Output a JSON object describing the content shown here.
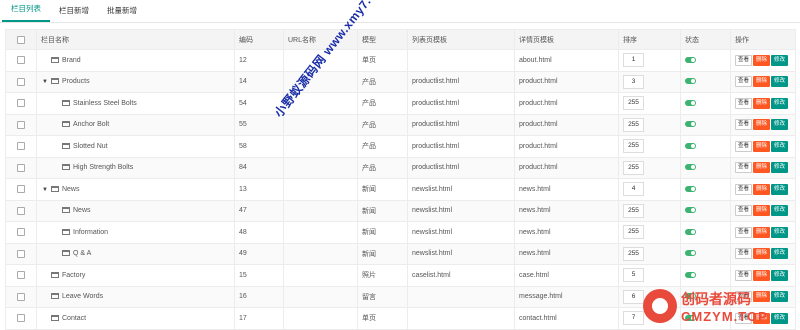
{
  "tabs": [
    "栏目列表",
    "栏目新增",
    "批量新增"
  ],
  "columns": [
    "",
    "栏目名称",
    "编码",
    "URL名称",
    "模型",
    "列表页模板",
    "详情页模板",
    "排序",
    "状态",
    "操作"
  ],
  "actions": {
    "view": "查看",
    "delete": "删除",
    "edit": "修改"
  },
  "rows": [
    {
      "name": "Brand",
      "code": "12",
      "url": "",
      "model": "单页",
      "list_tpl": "",
      "detail_tpl": "about.html",
      "sort": "1",
      "level": 1,
      "expanded": false
    },
    {
      "name": "Products",
      "code": "14",
      "url": "",
      "model": "产品",
      "list_tpl": "productlist.html",
      "detail_tpl": "product.html",
      "sort": "3",
      "level": 1,
      "expanded": true
    },
    {
      "name": "Stainless Steel Bolts",
      "code": "54",
      "url": "",
      "model": "产品",
      "list_tpl": "productlist.html",
      "detail_tpl": "product.html",
      "sort": "255",
      "level": 2,
      "expanded": false
    },
    {
      "name": "Anchor Bolt",
      "code": "55",
      "url": "",
      "model": "产品",
      "list_tpl": "productlist.html",
      "detail_tpl": "product.html",
      "sort": "255",
      "level": 2,
      "expanded": false
    },
    {
      "name": "Slotted Nut",
      "code": "58",
      "url": "",
      "model": "产品",
      "list_tpl": "productlist.html",
      "detail_tpl": "product.html",
      "sort": "255",
      "level": 2,
      "expanded": false
    },
    {
      "name": "High Strength Bolts",
      "code": "84",
      "url": "",
      "model": "产品",
      "list_tpl": "productlist.html",
      "detail_tpl": "product.html",
      "sort": "255",
      "level": 2,
      "expanded": false
    },
    {
      "name": "News",
      "code": "13",
      "url": "",
      "model": "新闻",
      "list_tpl": "newslist.html",
      "detail_tpl": "news.html",
      "sort": "4",
      "level": 1,
      "expanded": true
    },
    {
      "name": "News",
      "code": "47",
      "url": "",
      "model": "新闻",
      "list_tpl": "newslist.html",
      "detail_tpl": "news.html",
      "sort": "255",
      "level": 2,
      "expanded": false
    },
    {
      "name": "Information",
      "code": "48",
      "url": "",
      "model": "新闻",
      "list_tpl": "newslist.html",
      "detail_tpl": "news.html",
      "sort": "255",
      "level": 2,
      "expanded": false
    },
    {
      "name": "Q & A",
      "code": "49",
      "url": "",
      "model": "新闻",
      "list_tpl": "newslist.html",
      "detail_tpl": "news.html",
      "sort": "255",
      "level": 2,
      "expanded": false
    },
    {
      "name": "Factory",
      "code": "15",
      "url": "",
      "model": "照片",
      "list_tpl": "caselist.html",
      "detail_tpl": "case.html",
      "sort": "5",
      "level": 1,
      "expanded": false
    },
    {
      "name": "Leave Words",
      "code": "16",
      "url": "",
      "model": "留言",
      "list_tpl": "",
      "detail_tpl": "message.html",
      "sort": "6",
      "level": 1,
      "expanded": false
    },
    {
      "name": "Contact",
      "code": "17",
      "url": "",
      "model": "单页",
      "list_tpl": "",
      "detail_tpl": "contact.html",
      "sort": "7",
      "level": 1,
      "expanded": false
    }
  ],
  "watermark": "小野蚁源码网 www.xmy7.com",
  "logo": {
    "cn": "创码者源码",
    "en": "CMZYM.TOP"
  }
}
